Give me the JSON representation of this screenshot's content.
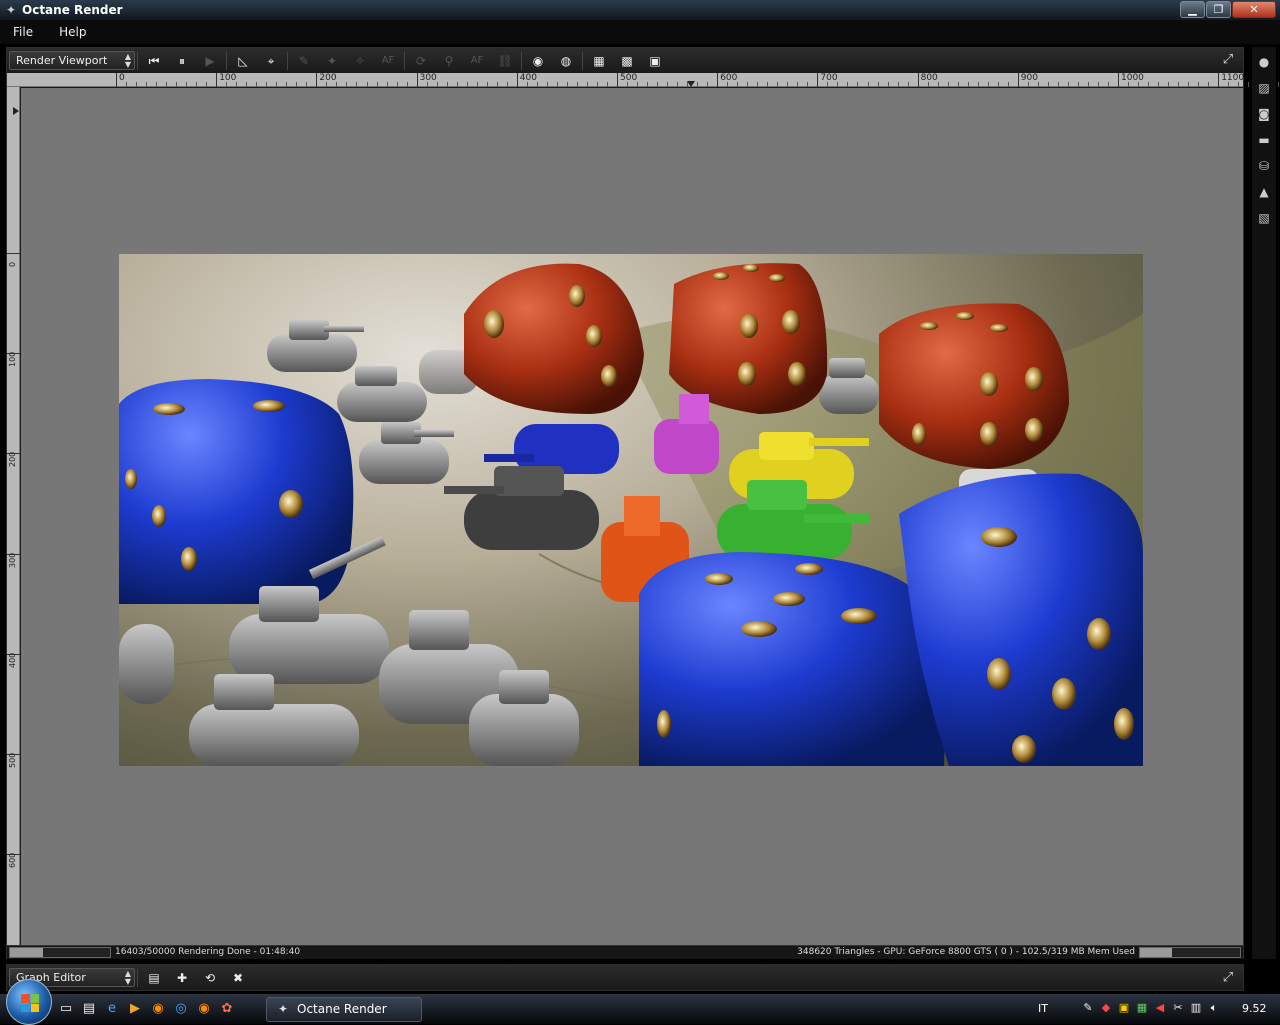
{
  "window": {
    "title": "Octane Render"
  },
  "menu": {
    "items": [
      "File",
      "Help"
    ]
  },
  "viewport": {
    "panel_select": "Render Viewport",
    "toolbar_buttons": [
      {
        "name": "rewind-icon",
        "glyph": "⏮",
        "enabled": true
      },
      {
        "name": "pause-icon",
        "glyph": "⏸",
        "enabled": true
      },
      {
        "name": "play-icon",
        "glyph": "▶",
        "enabled": false
      },
      {
        "name": "ruler-icon",
        "glyph": "◺",
        "enabled": true
      },
      {
        "name": "focus-picker-icon",
        "glyph": "⌖",
        "enabled": true
      },
      {
        "name": "pick-material-icon",
        "glyph": "✎",
        "enabled": false
      },
      {
        "name": "pick-object-icon",
        "glyph": "✦",
        "enabled": false
      },
      {
        "name": "pick-focus-icon",
        "glyph": "✧",
        "enabled": false
      },
      {
        "name": "autofocus-icon",
        "glyph": "AF",
        "enabled": false
      },
      {
        "name": "refresh-icon",
        "glyph": "⟳",
        "enabled": false
      },
      {
        "name": "zoom-tool-icon",
        "glyph": "⚲",
        "enabled": false
      },
      {
        "name": "af-toggle-icon",
        "glyph": "AF",
        "enabled": false
      },
      {
        "name": "link-icon",
        "glyph": "⛓",
        "enabled": false
      },
      {
        "name": "sphere-icon",
        "glyph": "◉",
        "enabled": true
      },
      {
        "name": "sphere-alt-icon",
        "glyph": "◍",
        "enabled": true
      },
      {
        "name": "grid-fine-icon",
        "glyph": "▦",
        "enabled": true
      },
      {
        "name": "checker-icon",
        "glyph": "▩",
        "enabled": true
      },
      {
        "name": "checker-large-icon",
        "glyph": "▣",
        "enabled": true
      }
    ],
    "ruler_h_labels": [
      "0",
      "100",
      "200",
      "300",
      "400",
      "500",
      "600",
      "700",
      "800",
      "900",
      "1000",
      "1100"
    ],
    "ruler_v_labels": [
      "0",
      "100",
      "200",
      "300",
      "400",
      "500",
      "600"
    ]
  },
  "status": {
    "left": "16403/50000 Rendering Done - 01:48:40",
    "right": "348620 Triangles - GPU: GeForce 8800 GTS ( 0 ) - 102.5/319 MB Mem Used",
    "progress": 0.328,
    "mem": 0.321
  },
  "graph_editor": {
    "panel_select": "Graph Editor",
    "buttons": [
      {
        "name": "save-icon",
        "glyph": "▤"
      },
      {
        "name": "node-add-icon",
        "glyph": "✚"
      },
      {
        "name": "node-link-icon",
        "glyph": "⟲"
      },
      {
        "name": "node-delete-icon",
        "glyph": "✖"
      }
    ]
  },
  "sidebar": {
    "icons": [
      "circle-icon",
      "image-icon",
      "camera-icon",
      "layers-icon",
      "database-icon",
      "picture-icon",
      "texture-icon"
    ]
  },
  "taskbar": {
    "active_task": "Octane Render",
    "language": "IT",
    "clock": "9.52"
  }
}
